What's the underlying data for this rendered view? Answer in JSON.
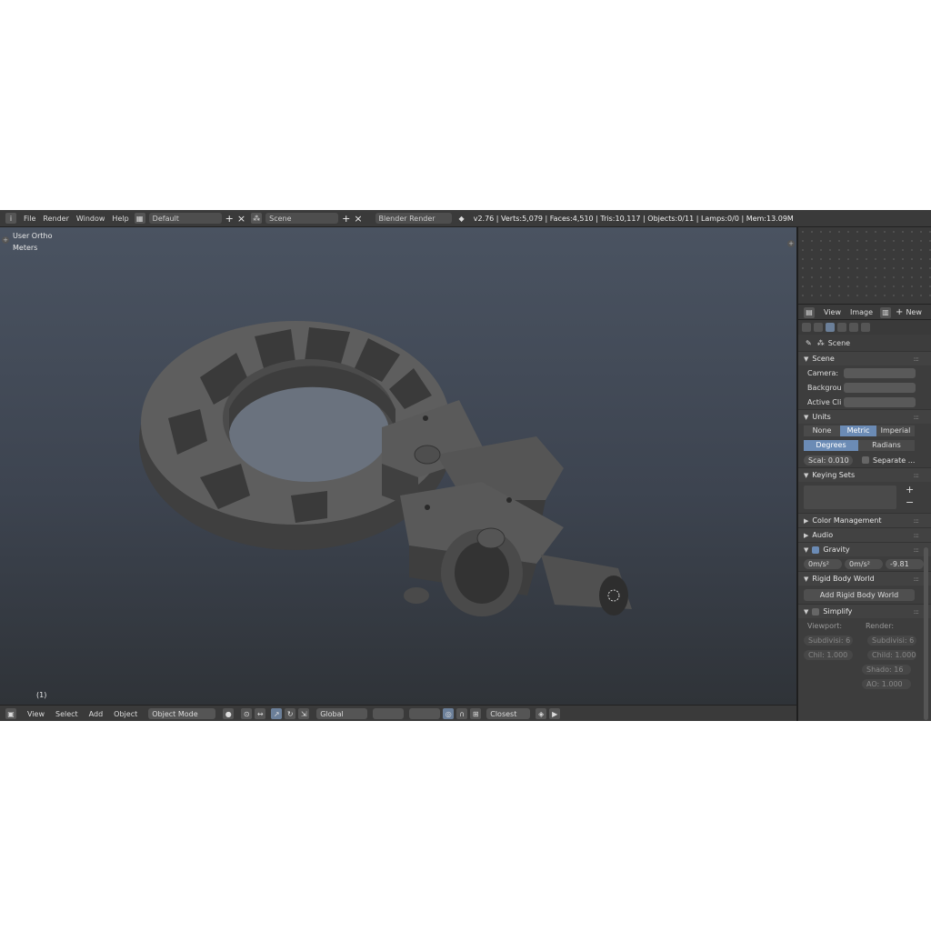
{
  "topbar": {
    "menus": [
      "File",
      "Render",
      "Window",
      "Help"
    ],
    "layout": "Default",
    "scene": "Scene",
    "engine": "Blender Render",
    "stats": "v2.76 | Verts:5,079 | Faces:4,510 | Tris:10,117 | Objects:0/11 | Lamps:0/0 | Mem:13.09M"
  },
  "viewport": {
    "view_name": "User Ortho",
    "units": "Meters",
    "frame": "(1)"
  },
  "bottombar": {
    "menus": [
      "View",
      "Select",
      "Add",
      "Object"
    ],
    "mode": "Object Mode",
    "orientation": "Global",
    "snap": "Closest"
  },
  "uv_header": {
    "view": "View",
    "image": "Image",
    "new": "New"
  },
  "props": {
    "path": "Scene",
    "scene_panel": {
      "title": "Scene",
      "camera_label": "Camera:",
      "background_label": "Backgrou",
      "active_clip_label": "Active Cli"
    },
    "units_panel": {
      "title": "Units",
      "systems": [
        "None",
        "Metric",
        "Imperial"
      ],
      "rotation": [
        "Degrees",
        "Radians"
      ],
      "scale": "Scal: 0.010",
      "separate": "Separate ..."
    },
    "keying_sets": {
      "title": "Keying Sets"
    },
    "color_management": "Color Management",
    "audio": "Audio",
    "gravity": {
      "title": "Gravity",
      "x": "0m/s²",
      "y": "0m/s²",
      "z": "-9.81"
    },
    "rigid_body": {
      "title": "Rigid Body World",
      "button": "Add Rigid Body World"
    },
    "simplify": {
      "title": "Simplify",
      "viewport_label": "Viewport:",
      "render_label": "Render:",
      "subdiv_viewport": "Subdivisi: 6",
      "subdiv_render": "Subdivisi: 6",
      "child_viewport": "Chil: 1.000",
      "child_render": "Child: 1.000",
      "shadow": "Shado: 16",
      "ao": "AO: 1.000"
    }
  },
  "colors": {
    "accent": "#6b8bb5",
    "header": "#3a3a3a",
    "viewport_top": "#4a5361",
    "viewport_bottom": "#2f3338"
  }
}
